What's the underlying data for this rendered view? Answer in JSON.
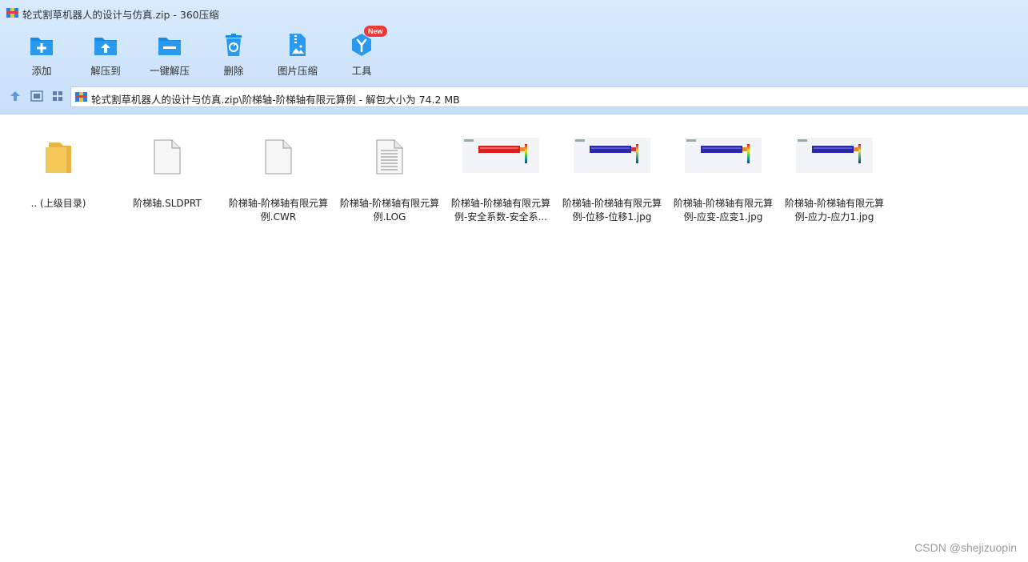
{
  "window": {
    "title": "轮式割草机器人的设计与仿真.zip - 360压缩"
  },
  "toolbar": {
    "buttons": [
      {
        "label": "添加",
        "icon": "add-icon"
      },
      {
        "label": "解压到",
        "icon": "extract-to-icon"
      },
      {
        "label": "一键解压",
        "icon": "one-click-extract-icon"
      },
      {
        "label": "删除",
        "icon": "delete-icon"
      },
      {
        "label": "图片压缩",
        "icon": "image-compress-icon"
      },
      {
        "label": "工具",
        "icon": "tools-icon",
        "badge": "New"
      }
    ]
  },
  "nav": {
    "path": "轮式割草机器人的设计与仿真.zip\\阶梯轴-阶梯轴有限元算例 - 解包大小为 74.2 MB"
  },
  "files": [
    {
      "name": ".. (上级目录)",
      "icon": "folder-icon"
    },
    {
      "name": "阶梯轴.SLDPRT",
      "icon": "blank-file-icon"
    },
    {
      "name": "阶梯轴-阶梯轴有限元算例.CWR",
      "icon": "blank-file-icon"
    },
    {
      "name": "阶梯轴-阶梯轴有限元算例.LOG",
      "icon": "text-file-icon"
    },
    {
      "name": "阶梯轴-阶梯轴有限元算例-安全系数-安全系...",
      "icon": "image-thumbnail",
      "bar_color": "#d62020"
    },
    {
      "name": "阶梯轴-阶梯轴有限元算例-位移-位移1.jpg",
      "icon": "image-thumbnail",
      "bar_color": "#2a2aa8"
    },
    {
      "name": "阶梯轴-阶梯轴有限元算例-应变-应变1.jpg",
      "icon": "image-thumbnail",
      "bar_color": "#2a2aa8"
    },
    {
      "name": "阶梯轴-阶梯轴有限元算例-应力-应力1.jpg",
      "icon": "image-thumbnail",
      "bar_color": "#2a2aa8"
    }
  ],
  "watermark": "CSDN @shejizuopin",
  "colors": {
    "accent_blue": "#1a8be3",
    "badge_red": "#ea3a3a",
    "folder_yellow": "#f5c85a"
  }
}
